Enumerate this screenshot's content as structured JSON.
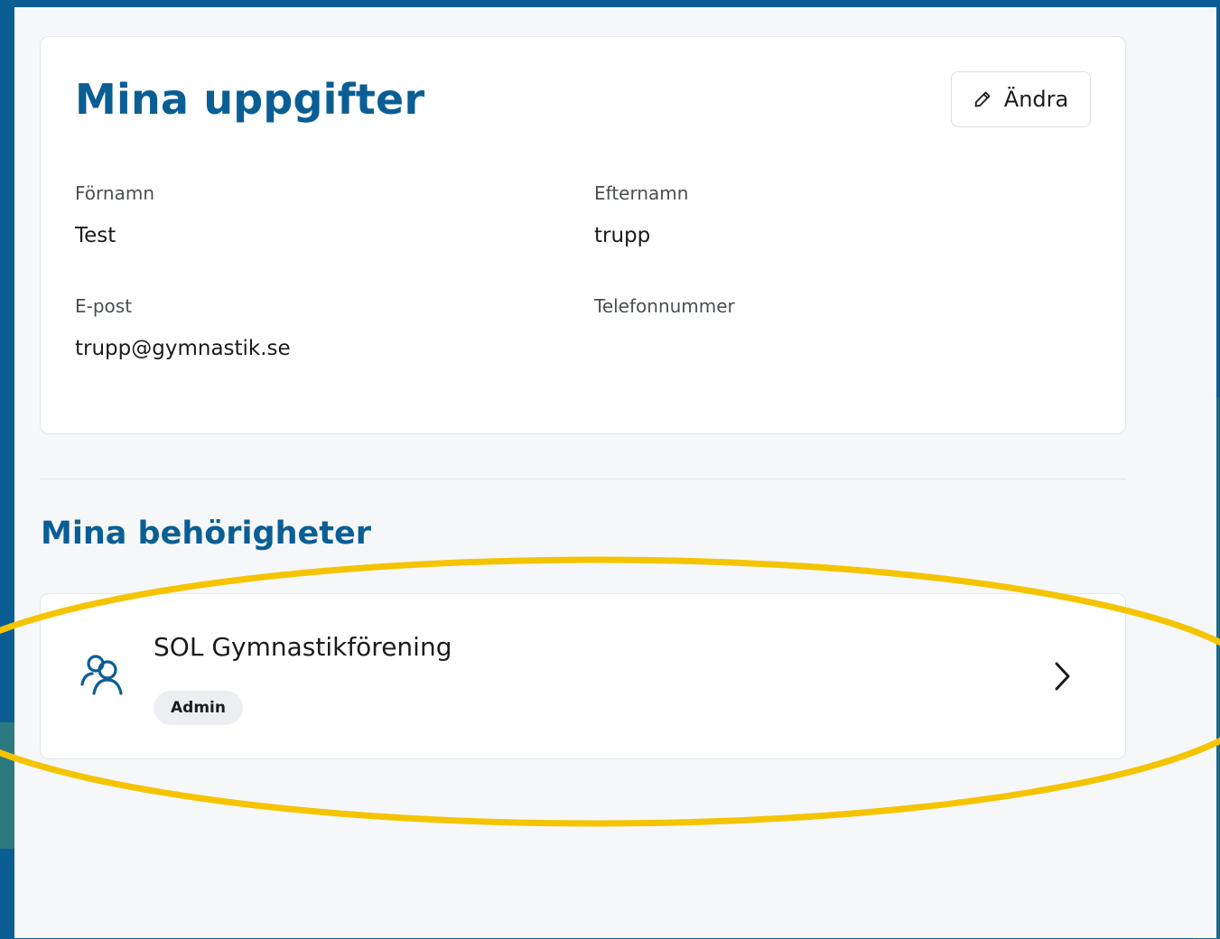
{
  "profile": {
    "title": "Mina uppgifter",
    "edit_label": "Ändra",
    "fields": {
      "first_name_label": "Förnamn",
      "first_name_value": "Test",
      "last_name_label": "Efternamn",
      "last_name_value": "trupp",
      "email_label": "E-post",
      "email_value": "trupp@gymnastik.se",
      "phone_label": "Telefonnummer",
      "phone_value": ""
    }
  },
  "permissions": {
    "title": "Mina behörigheter",
    "items": [
      {
        "organization": "SOL Gymnastikförening",
        "role": "Admin",
        "icon": "users-icon"
      }
    ]
  },
  "colors": {
    "brand": "#0a5e94",
    "highlight": "#f5c400",
    "page_bg": "#f6f7f9"
  },
  "icons": [
    "pencil-icon",
    "users-icon",
    "chevron-right-icon"
  ]
}
